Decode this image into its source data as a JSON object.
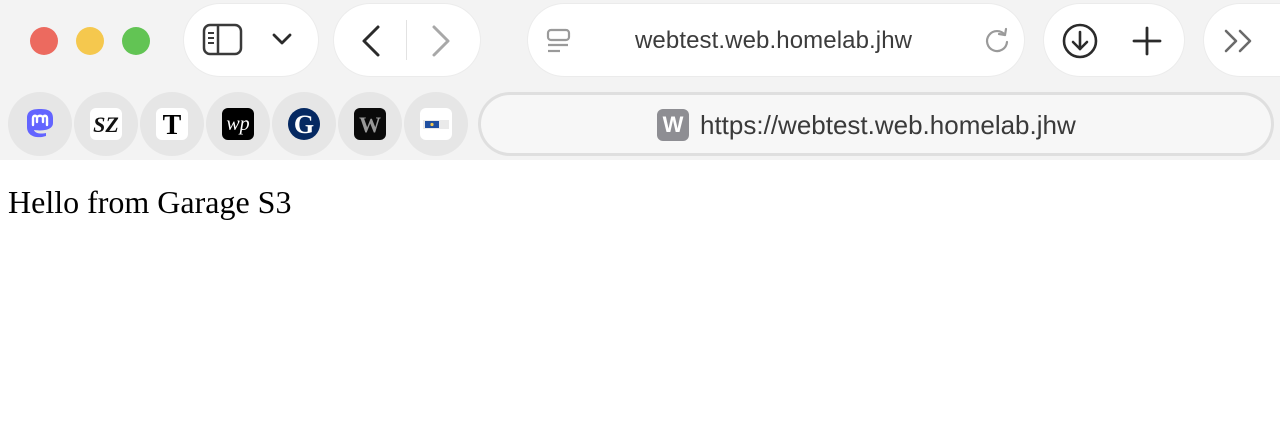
{
  "window": {
    "title": "webtest.web.homelab.jhw"
  },
  "toolbar": {
    "sidebar_icon": "sidebar-icon",
    "tab_overview_icon": "chevron-down-icon",
    "back_icon": "chevron-left-icon",
    "forward_icon": "chevron-right-icon",
    "page_icon": "reader-icon",
    "reload_icon": "reload-icon",
    "download_icon": "download-icon",
    "new_tab_icon": "plus-icon",
    "more_icon": "double-chevron-icon"
  },
  "favorites": [
    {
      "name": "mastodon",
      "icon": "mastodon-icon",
      "color": "#6364ff"
    },
    {
      "name": "sz",
      "icon": "sz-icon",
      "glyph": "SZ"
    },
    {
      "name": "nyt",
      "icon": "nyt-icon",
      "glyph": "T"
    },
    {
      "name": "wp",
      "icon": "washington-post-icon",
      "glyph": "wp"
    },
    {
      "name": "guardian",
      "icon": "guardian-icon",
      "glyph": "G",
      "color": "#052962"
    },
    {
      "name": "w-dark",
      "icon": "w-dark-icon",
      "glyph": "W"
    },
    {
      "name": "eu",
      "icon": "eu-icon",
      "color": "#1f4fa0"
    }
  ],
  "address_bar": {
    "badge": "W",
    "url": "https://webtest.web.homelab.jhw"
  },
  "page": {
    "text": "Hello from Garage S3"
  },
  "colors": {
    "close": "#ec6a5f",
    "minimize": "#f5c84e",
    "maximize": "#62c454"
  }
}
